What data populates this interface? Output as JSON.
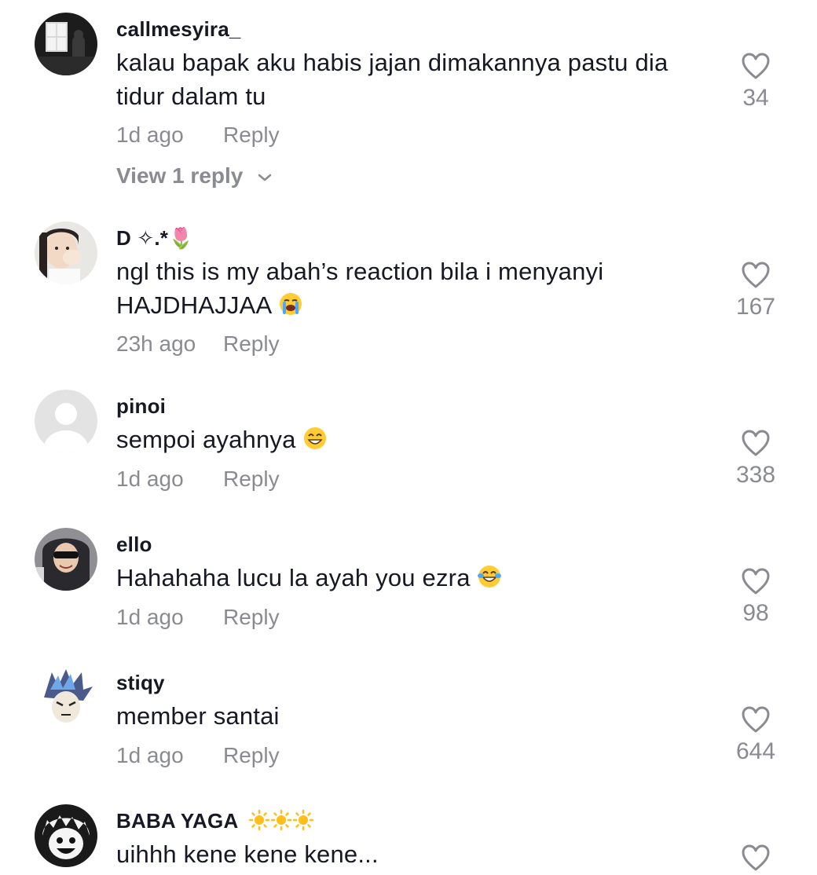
{
  "comments": [
    {
      "username": "callmesyira_",
      "text": "kalau bapak aku habis jajan dimakannya pastu dia tidur dalam tu",
      "time": "1d ago",
      "reply": "Reply",
      "likes": "34",
      "view_replies": "View 1 reply"
    },
    {
      "username": "D ✧.*🌷",
      "text": "ngl this is my abah’s reaction bila i menyanyi HAJDHAJJAA",
      "time": "23h ago",
      "reply": "Reply",
      "likes": "167"
    },
    {
      "username": "pinoi",
      "text": "sempoi ayahnya",
      "time": "1d ago",
      "reply": "Reply",
      "likes": "338"
    },
    {
      "username": "ello",
      "text": "Hahahaha lucu la ayah you ezra",
      "time": "1d ago",
      "reply": "Reply",
      "likes": "98"
    },
    {
      "username": "stiqy",
      "text": "member santai",
      "time": "1d ago",
      "reply": "Reply",
      "likes": "644"
    },
    {
      "username": "BABA YAGA",
      "text": "uihhh kene kene kene...",
      "time": "",
      "reply": "",
      "likes": ""
    }
  ],
  "emojis": {
    "comment2": "loudly-crying-face",
    "comment3": "grinning-face-with-smiling-eyes",
    "comment4": "face-with-tears-of-joy",
    "comment6_username": "sun-x3"
  },
  "colors": {
    "text": "#161823",
    "muted": "#8a8b91",
    "heart_outline": "#8a8b91"
  },
  "icons": {
    "like": "heart-outline-icon",
    "expand": "chevron-down-icon"
  }
}
